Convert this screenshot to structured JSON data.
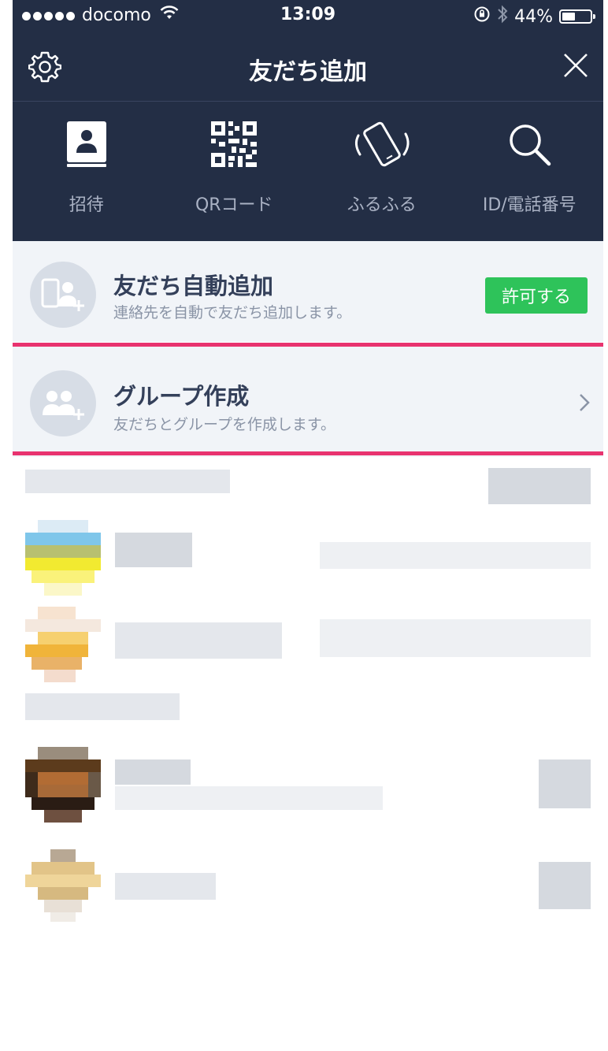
{
  "status_bar": {
    "carrier": "docomo",
    "time": "13:09",
    "battery": "44%"
  },
  "nav": {
    "title": "友だち追加"
  },
  "actions": [
    {
      "label": "招待",
      "icon": "contact-book-icon"
    },
    {
      "label": "QRコード",
      "icon": "qr-code-icon"
    },
    {
      "label": "ふるふる",
      "icon": "shake-phone-icon"
    },
    {
      "label": "ID/電話番号",
      "icon": "search-icon"
    }
  ],
  "auto_add": {
    "title": "友だち自動追加",
    "description": "連絡先を自動で友だち追加します。",
    "button_label": "許可する"
  },
  "group_create": {
    "title": "グループ作成",
    "description": "友だちとグループを作成します。"
  },
  "colors": {
    "header_bg": "#232e45",
    "row_bg": "#f1f4f8",
    "accent_green": "#2ec35a",
    "highlight": "#e8336f"
  }
}
